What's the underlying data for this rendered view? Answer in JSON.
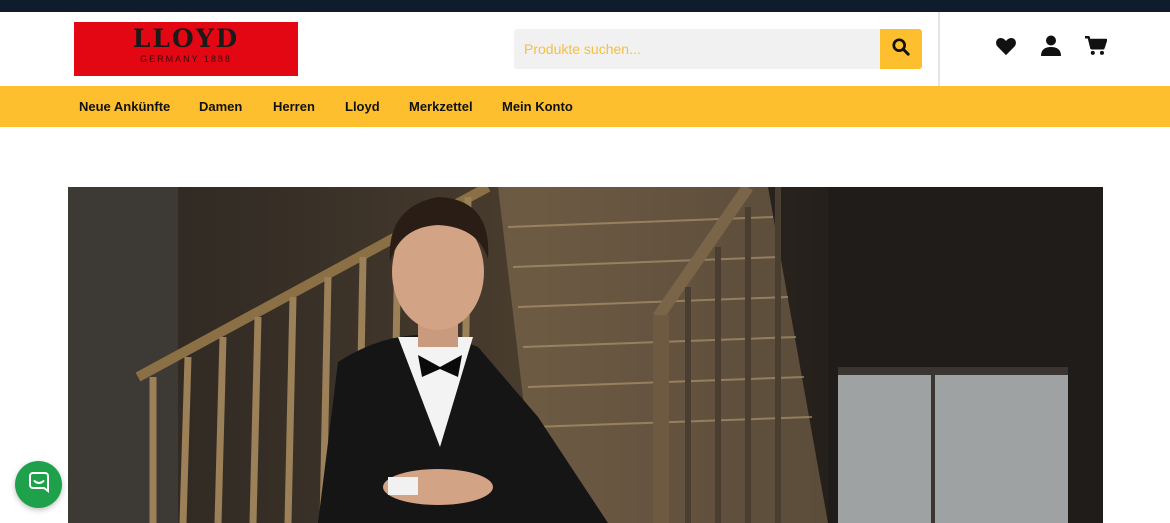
{
  "brand": {
    "name": "LLOYD",
    "tagline": "GERMANY 1888",
    "colors": {
      "logo_bg": "#e30613",
      "accent": "#fdbf2d",
      "topbar": "#0f1c2b",
      "chat": "#1fa04a"
    }
  },
  "search": {
    "placeholder": "Produkte suchen...",
    "value": "",
    "button_icon": "search-icon"
  },
  "header_icons": [
    {
      "name": "wishlist",
      "icon": "heart-icon"
    },
    {
      "name": "account",
      "icon": "user-icon"
    },
    {
      "name": "cart",
      "icon": "cart-icon"
    }
  ],
  "nav": {
    "items": [
      {
        "label": "Neue Ankünfte"
      },
      {
        "label": "Damen"
      },
      {
        "label": "Herren"
      },
      {
        "label": "Lloyd"
      },
      {
        "label": "Merkzettel"
      },
      {
        "label": "Mein Konto"
      }
    ]
  },
  "hero": {
    "image": "man-in-tuxedo-on-staircase"
  },
  "chat": {
    "icon": "chat-icon"
  }
}
